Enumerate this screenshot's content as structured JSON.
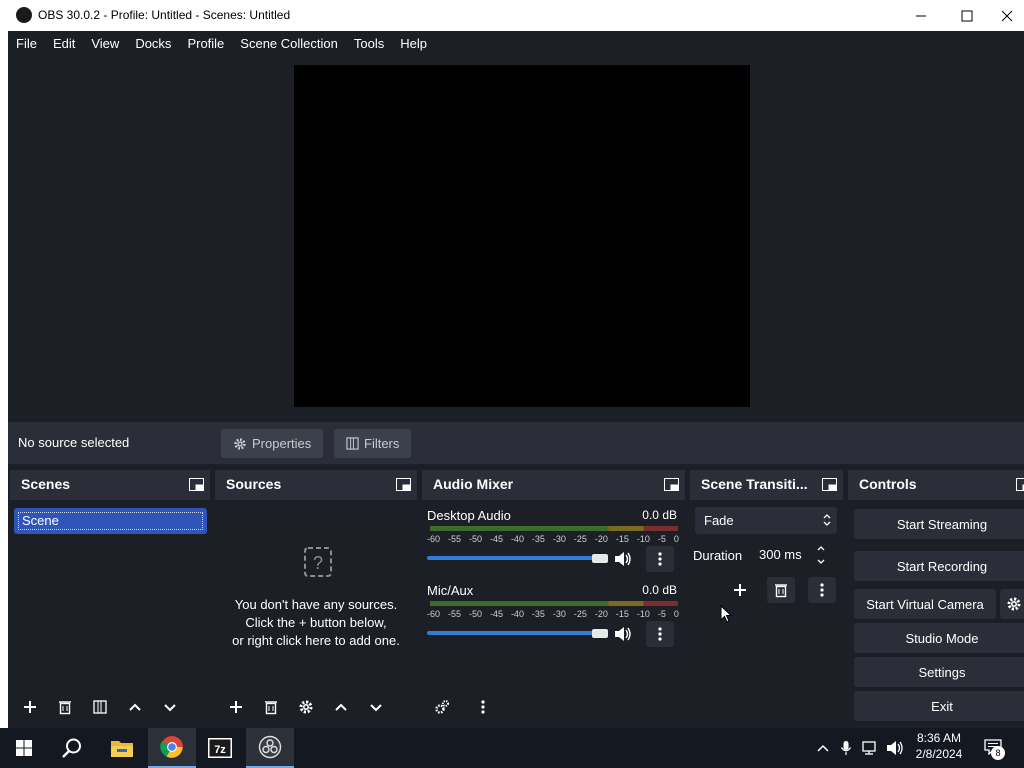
{
  "window": {
    "title": "OBS 30.0.2 - Profile: Untitled - Scenes: Untitled"
  },
  "menu": [
    "File",
    "Edit",
    "View",
    "Docks",
    "Profile",
    "Scene Collection",
    "Tools",
    "Help"
  ],
  "context_bar": {
    "source_label": "No source selected",
    "properties_label": "Properties",
    "filters_label": "Filters"
  },
  "scenes": {
    "title": "Scenes",
    "items": [
      "Scene"
    ]
  },
  "sources": {
    "title": "Sources",
    "empty_line1": "You don't have any sources.",
    "empty_line2": "Click the + button below,",
    "empty_line3": "or right click here to add one."
  },
  "audio_mixer": {
    "title": "Audio Mixer",
    "ticks": [
      "-60",
      "-55",
      "-50",
      "-45",
      "-40",
      "-35",
      "-30",
      "-25",
      "-20",
      "-15",
      "-10",
      "-5",
      "0"
    ],
    "channels": [
      {
        "name": "Desktop Audio",
        "level": "0.0 dB"
      },
      {
        "name": "Mic/Aux",
        "level": "0.0 dB"
      }
    ]
  },
  "transitions": {
    "title": "Scene Transiti...",
    "selected": "Fade",
    "duration_label": "Duration",
    "duration_value": "300 ms"
  },
  "controls": {
    "title": "Controls",
    "start_streaming": "Start Streaming",
    "start_recording": "Start Recording",
    "start_virtual_camera": "Start Virtual Camera",
    "studio_mode": "Studio Mode",
    "settings": "Settings",
    "exit": "Exit"
  },
  "taskbar": {
    "time": "8:36 AM",
    "date": "2/8/2024",
    "notification_count": "8"
  },
  "colors": {
    "accent": "#2f55b8",
    "slider": "#2f7fd8",
    "dock_bg": "#1d1f26"
  }
}
